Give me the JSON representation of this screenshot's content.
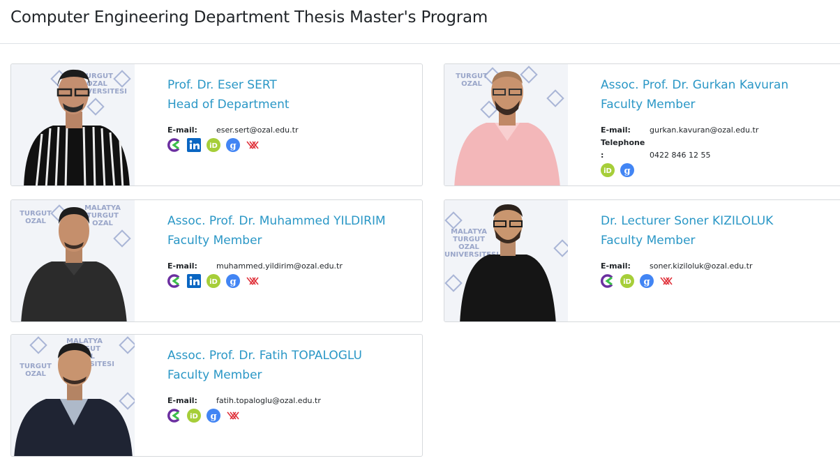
{
  "page": {
    "title": "Computer Engineering Department Thesis Master's Program"
  },
  "watermark": {
    "line1": "MALATYA",
    "line2": "TURGUT OZAL",
    "line3": "UNIVERSITESI"
  },
  "labels": {
    "email": "E-mail:",
    "telephone_line1": "Telephone",
    "telephone_line2": ":"
  },
  "members": [
    {
      "name": "Prof. Dr. Eser SERT",
      "role": "Head of Department",
      "email": "eser.sert@ozal.edu.tr",
      "icons": [
        "avesis-icon",
        "linkedin-icon",
        "orcid-icon",
        "google-scholar-icon",
        "yok-academic-icon"
      ]
    },
    {
      "name": "Assoc. Prof. Dr. Gurkan Kavuran",
      "role": "Faculty Member",
      "email": "gurkan.kavuran@ozal.edu.tr",
      "telephone": "0422 846 12 55",
      "icons": [
        "orcid-icon",
        "google-scholar-icon"
      ]
    },
    {
      "name": "Assoc. Prof. Dr. Muhammed YILDIRIM",
      "role": "Faculty Member",
      "email": "muhammed.yildirim@ozal.edu.tr",
      "icons": [
        "avesis-icon",
        "linkedin-icon",
        "orcid-icon",
        "google-scholar-icon",
        "yok-academic-icon"
      ]
    },
    {
      "name": "Dr. Lecturer Soner KIZILOLUK",
      "role": "Faculty Member",
      "email": "soner.kiziloluk@ozal.edu.tr",
      "icons": [
        "avesis-icon",
        "orcid-icon",
        "google-scholar-icon",
        "yok-academic-icon"
      ]
    },
    {
      "name": "Assoc. Prof. Dr. Fatih TOPALOGLU",
      "role": "Faculty Member",
      "email": "fatih.topaloglu@ozal.edu.tr",
      "icons": [
        "avesis-icon",
        "orcid-icon",
        "google-scholar-icon",
        "yok-academic-icon"
      ]
    }
  ],
  "colors": {
    "name_link": "#2a97c6",
    "linkedin": "#0a66c2",
    "orcid": "#a6ce39",
    "google_scholar": "#4285f4",
    "yok_academic": "#e0313a",
    "avesis_purple": "#6b2fa0",
    "avesis_green": "#3cbf4a"
  }
}
